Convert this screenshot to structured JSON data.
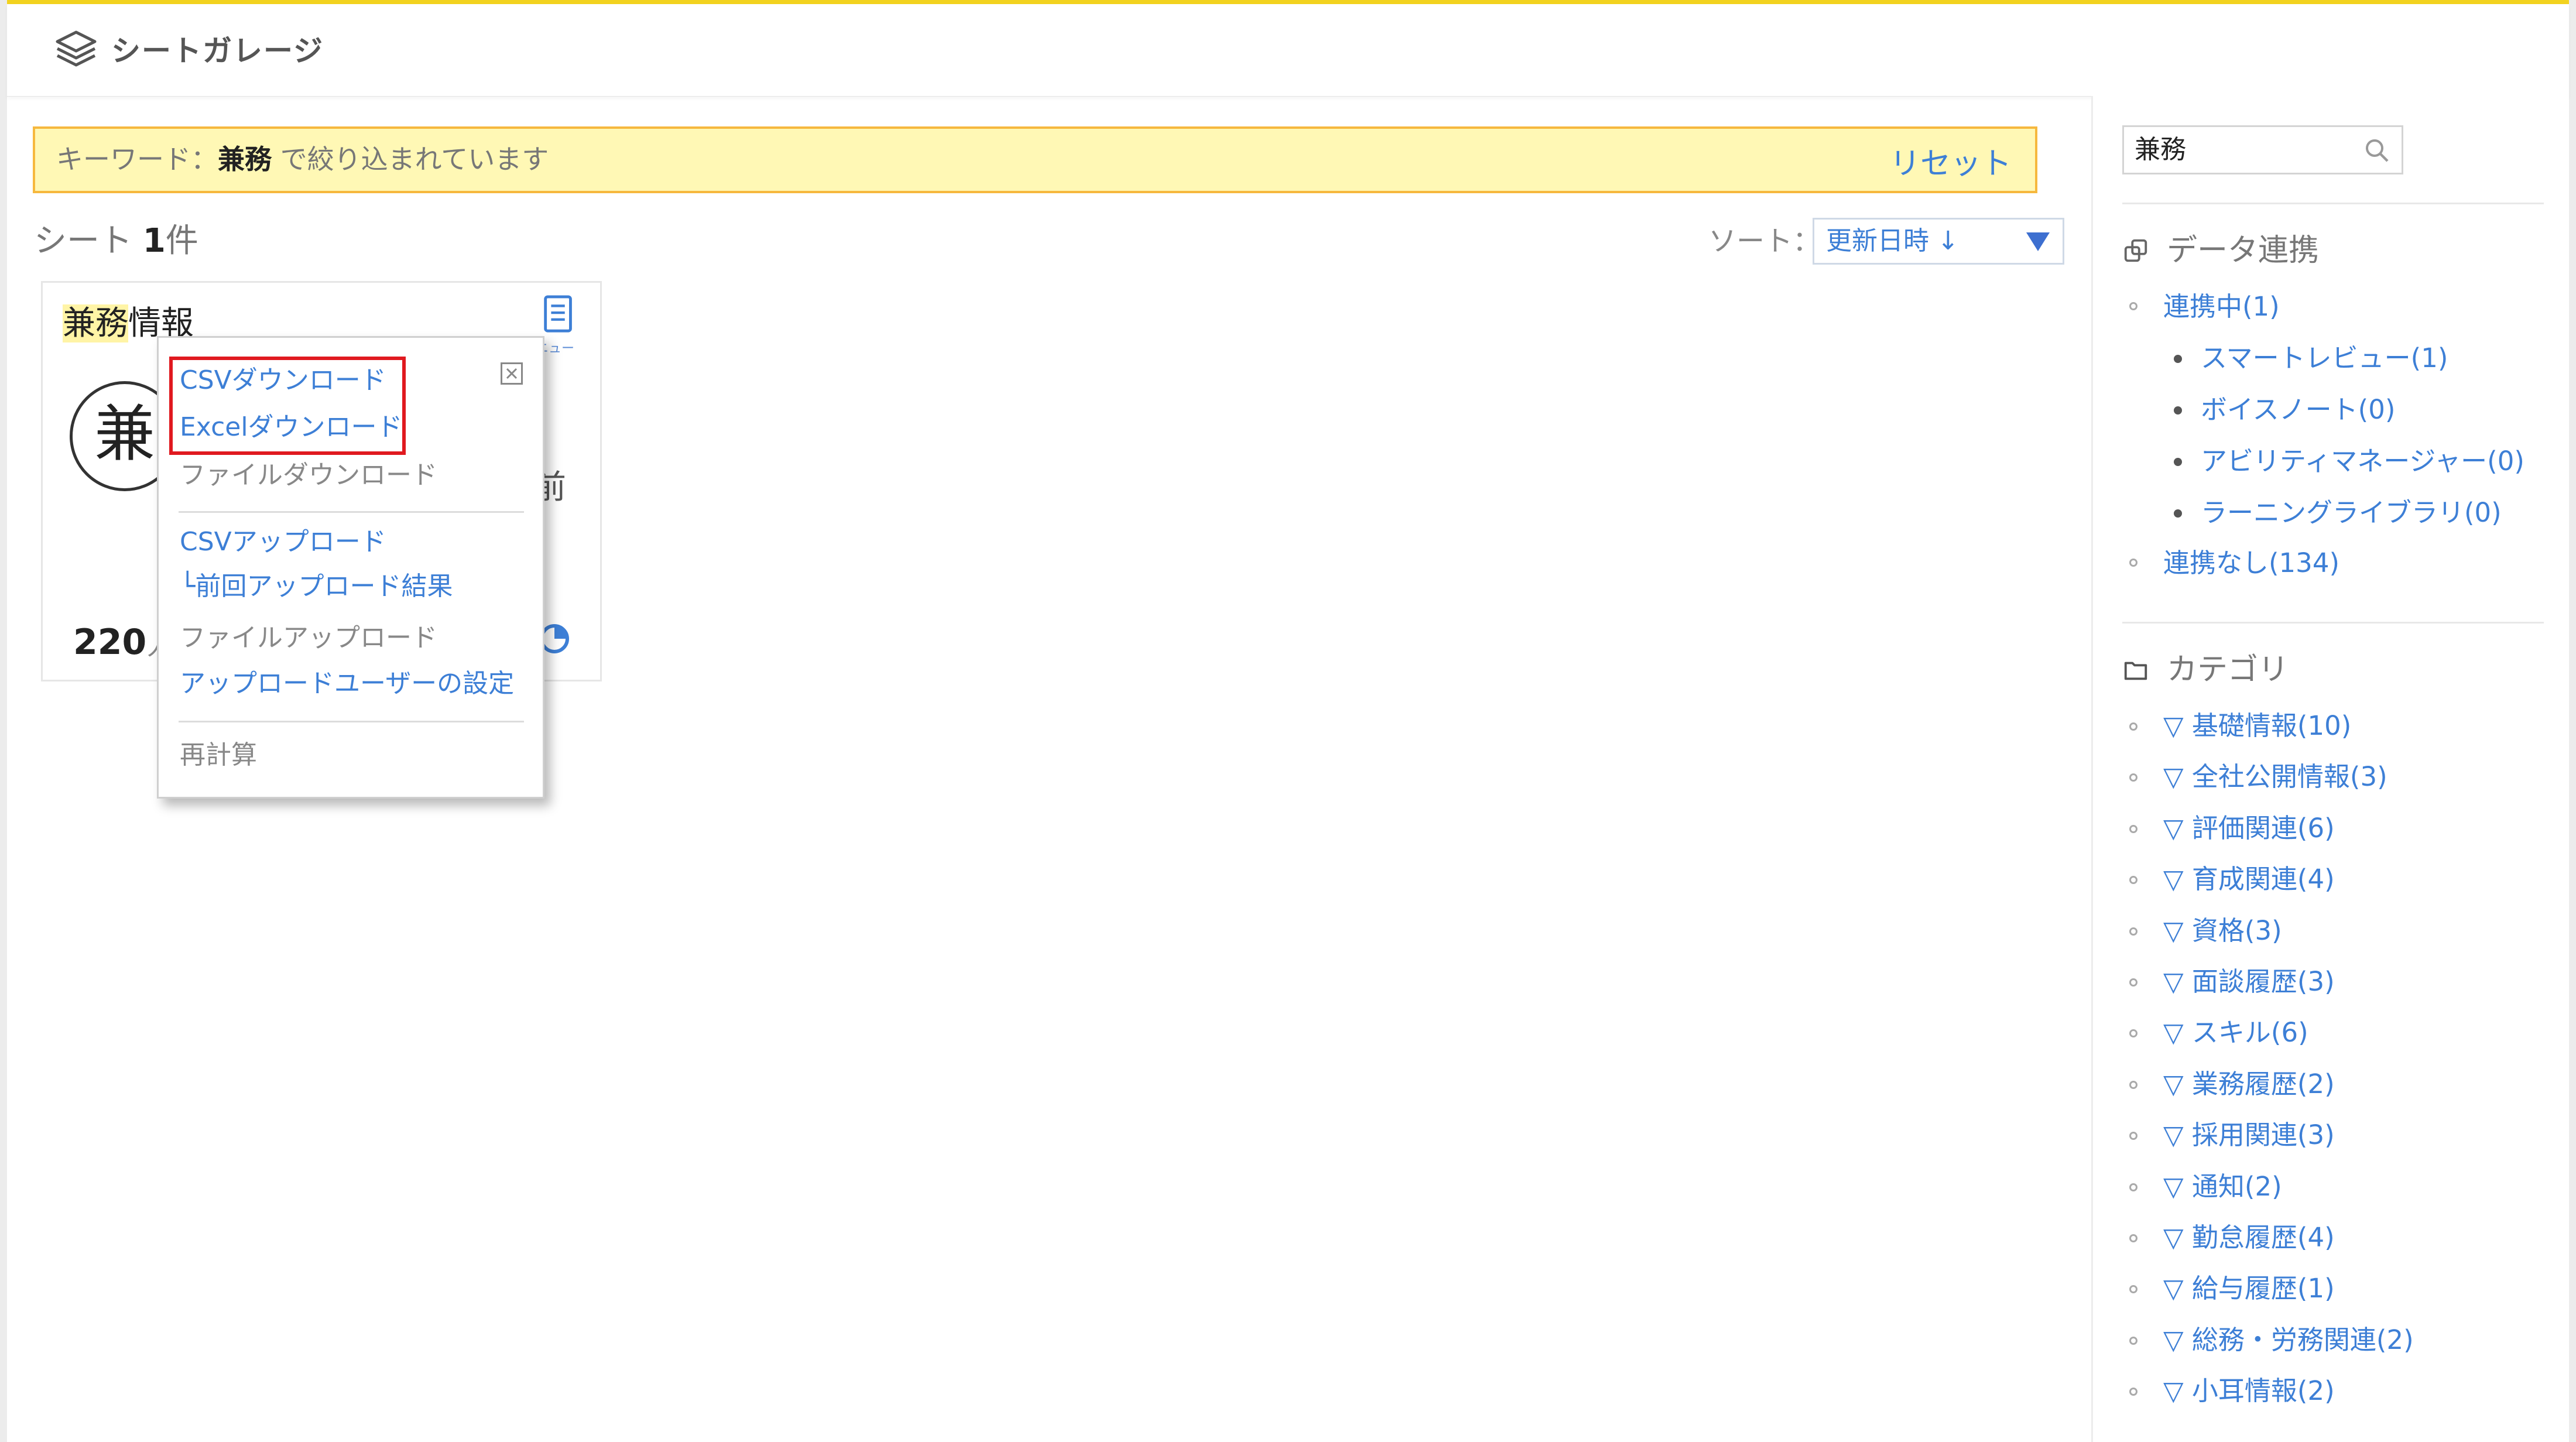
{
  "header": {
    "title": "シートガレージ"
  },
  "filter": {
    "prefix": "キーワード：",
    "keyword": "兼務",
    "suffix": " で絞り込まれています",
    "reset": "リセット"
  },
  "count": {
    "label": "シート ",
    "value": "1",
    "unit": "件"
  },
  "sort": {
    "label": "ソート：",
    "value": "更新日時 ↓"
  },
  "card": {
    "title_highlight": "兼務",
    "title_rest": "情報",
    "menu_label": "ニュー",
    "circle_char": "兼",
    "side_char": "前",
    "persons": "220",
    "persons_unit": "人"
  },
  "popup": {
    "csv_download": "CSVダウンロード",
    "excel_download": "Excelダウンロード",
    "file_download": "ファイルダウンロード",
    "csv_upload": "CSVアップロード",
    "last_upload_result": "└前回アップロード結果",
    "file_upload": "ファイルアップロード",
    "upload_user_settings": "アップロードユーザーの設定",
    "recalc": "再計算"
  },
  "sidebar": {
    "search_value": "兼務",
    "data_link": {
      "title": "データ連携",
      "linked": "連携中(1)",
      "children": [
        "スマートレビュー(1)",
        "ボイスノート(0)",
        "アビリティマネージャー(0)",
        "ラーニングライブラリ(0)"
      ],
      "unlinked": "連携なし(134)"
    },
    "category": {
      "title": "カテゴリ",
      "items": [
        "▽ 基礎情報(10)",
        "▽ 全社公開情報(3)",
        "▽ 評価関連(6)",
        "▽ 育成関連(4)",
        "▽ 資格(3)",
        "▽ 面談履歴(3)",
        "▽ スキル(6)",
        "▽ 業務履歴(2)",
        "▽ 採用関連(3)",
        "▽ 通知(2)",
        "▽ 勤怠履歴(4)",
        "▽ 給与履歴(1)",
        "▽ 総務・労務関連(2)",
        "▽ 小耳情報(2)"
      ]
    }
  },
  "colors": {
    "accent": "#3d7fd6",
    "highlight_border": "#e0191f",
    "filter_bg": "#fff8b5",
    "filter_border": "#f6b83e",
    "top_bar": "#f2d21f"
  }
}
